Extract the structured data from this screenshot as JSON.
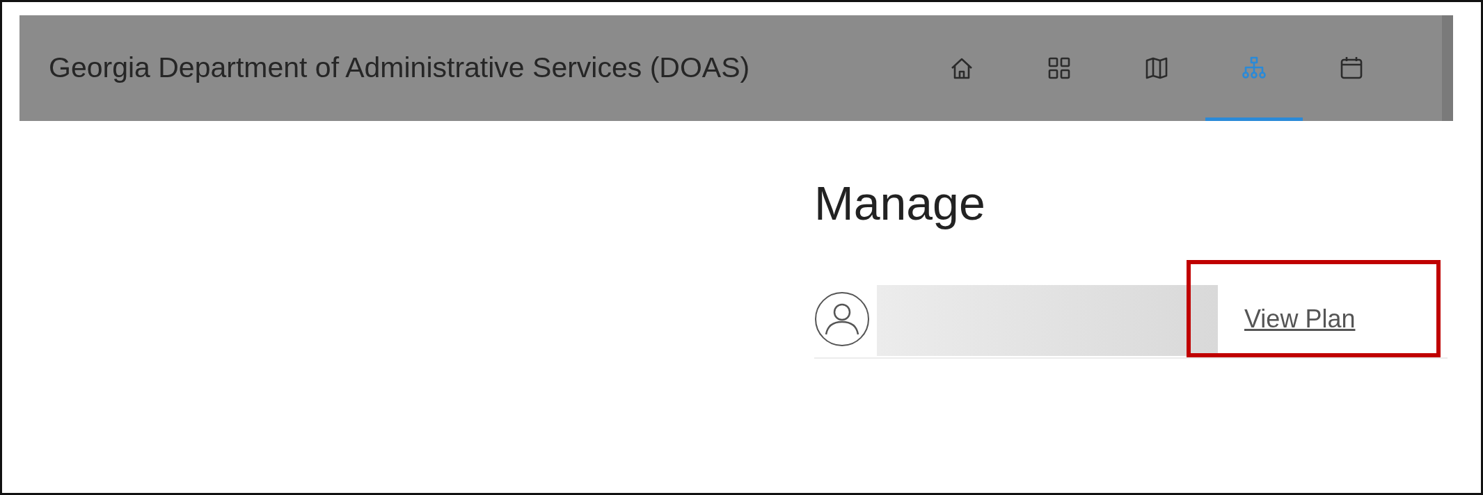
{
  "header": {
    "title": "Georgia Department of Administrative Services (DOAS)"
  },
  "nav_icons": [
    {
      "kind": "home",
      "selected": false
    },
    {
      "kind": "grid",
      "selected": false
    },
    {
      "kind": "map",
      "selected": false
    },
    {
      "kind": "org",
      "selected": true
    },
    {
      "kind": "calendar",
      "selected": false
    }
  ],
  "heading": "Manage",
  "plan_row": {
    "link": "View Plan",
    "highlighted": true
  }
}
